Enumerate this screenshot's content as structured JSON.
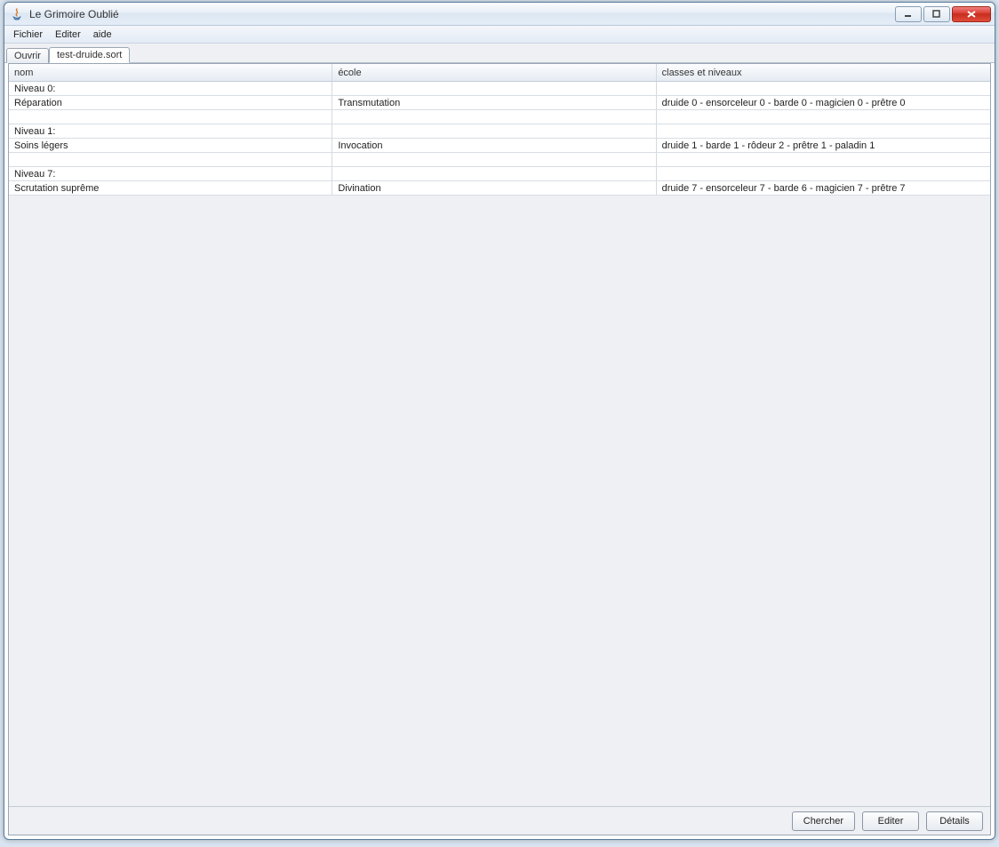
{
  "window": {
    "title": "Le Grimoire Oublié"
  },
  "menu": {
    "fichier": "Fichier",
    "editer": "Editer",
    "aide": "aide"
  },
  "tabs": [
    {
      "label": "Ouvrir",
      "active": false
    },
    {
      "label": "test-druide.sort",
      "active": true
    }
  ],
  "table": {
    "headers": {
      "nom": "nom",
      "ecole": "école",
      "classes": "classes et niveaux"
    },
    "rows": [
      {
        "nom": "Niveau 0:",
        "ecole": "",
        "classes": ""
      },
      {
        "nom": "Réparation",
        "ecole": "Transmutation",
        "classes": "druide 0 - ensorceleur 0 - barde 0 - magicien 0 - prêtre 0"
      },
      {
        "nom": "",
        "ecole": "",
        "classes": ""
      },
      {
        "nom": "Niveau 1:",
        "ecole": "",
        "classes": ""
      },
      {
        "nom": "Soins légers",
        "ecole": "Invocation",
        "classes": "druide 1 - barde 1 - rôdeur 2 - prêtre 1 - paladin 1"
      },
      {
        "nom": "",
        "ecole": "",
        "classes": ""
      },
      {
        "nom": "Niveau 7:",
        "ecole": "",
        "classes": ""
      },
      {
        "nom": "Scrutation suprême",
        "ecole": "Divination",
        "classes": "druide 7 - ensorceleur 7 - barde 6 - magicien 7 - prêtre 7"
      }
    ]
  },
  "footer": {
    "chercher": "Chercher",
    "editer": "Editer",
    "details": "Détails"
  }
}
